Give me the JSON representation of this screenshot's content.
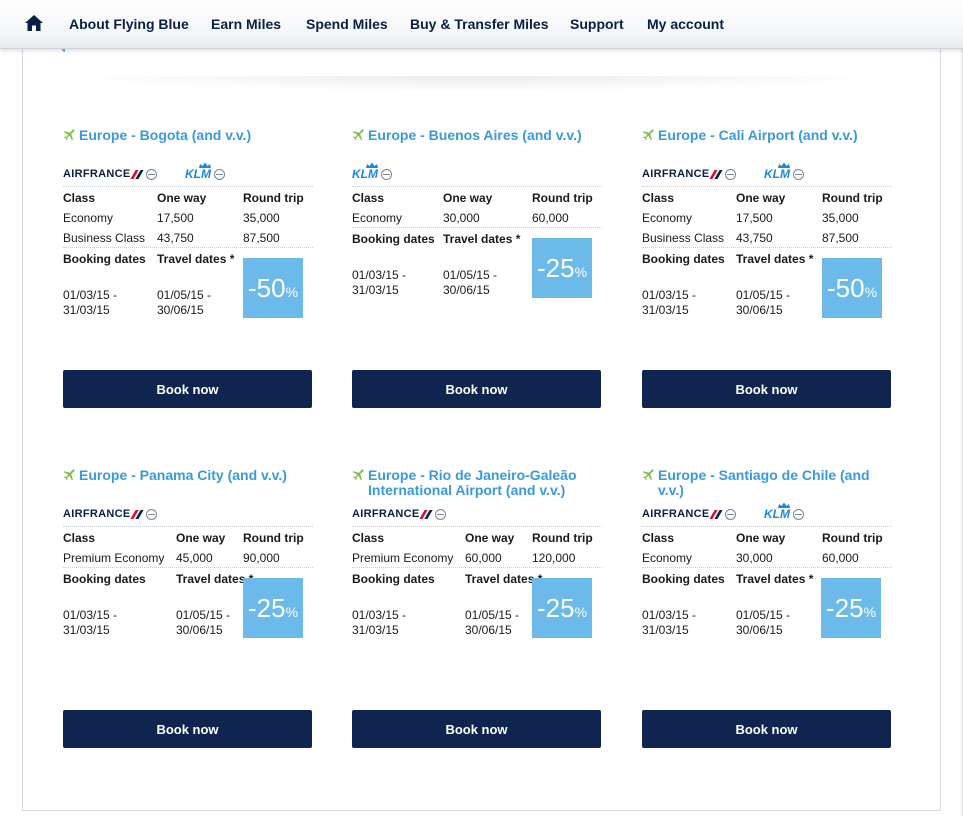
{
  "nav": {
    "items": [
      "About Flying Blue",
      "Earn Miles",
      "Spend Miles",
      "Buy & Transfer Miles",
      "Support",
      "My account"
    ]
  },
  "brand": {
    "airfrance": "AIRFRANCE",
    "klm": "KLM"
  },
  "table_headers": {
    "class": "Class",
    "one_way": "One way",
    "round_trip": "Round trip",
    "booking_dates": "Booking dates",
    "travel_dates": "Travel dates *"
  },
  "offers": [
    {
      "route": "Europe - Bogota (and v.v.)",
      "airlines": [
        "airfrance",
        "klm"
      ],
      "fares": [
        {
          "class": "Economy",
          "one_way": "17,500",
          "round_trip": "35,000"
        },
        {
          "class": "Business Class",
          "one_way": "43,750",
          "round_trip": "87,500"
        }
      ],
      "booking_from": "01/03/15 -",
      "booking_to": "31/03/15",
      "travel_from": "01/05/15 -",
      "travel_to": "30/06/15",
      "discount": "-50",
      "discount_unit": "%",
      "button": "Book now"
    },
    {
      "route": "Europe - Buenos Aires (and v.v.)",
      "airlines": [
        "klm"
      ],
      "fares": [
        {
          "class": "Economy",
          "one_way": "30,000",
          "round_trip": "60,000"
        }
      ],
      "booking_from": "01/03/15 -",
      "booking_to": "31/03/15",
      "travel_from": "01/05/15 -",
      "travel_to": "30/06/15",
      "discount": "-25",
      "discount_unit": "%",
      "button": "Book now"
    },
    {
      "route": "Europe - Cali Airport (and v.v.)",
      "airlines": [
        "airfrance",
        "klm"
      ],
      "fares": [
        {
          "class": "Economy",
          "one_way": "17,500",
          "round_trip": "35,000"
        },
        {
          "class": "Business Class",
          "one_way": "43,750",
          "round_trip": "87,500"
        }
      ],
      "booking_from": "01/03/15 -",
      "booking_to": "31/03/15",
      "travel_from": "01/05/15 -",
      "travel_to": "30/06/15",
      "discount": "-50",
      "discount_unit": "%",
      "button": "Book now"
    },
    {
      "route": "Europe - Panama City (and v.v.)",
      "airlines": [
        "airfrance"
      ],
      "fares": [
        {
          "class": "Premium Economy",
          "one_way": "45,000",
          "round_trip": "90,000"
        }
      ],
      "booking_from": "01/03/15 -",
      "booking_to": "31/03/15",
      "travel_from": "01/05/15 -",
      "travel_to": "30/06/15",
      "discount": "-25",
      "discount_unit": "%",
      "button": "Book now"
    },
    {
      "route": "Europe - Rio de Janeiro-Galeão International Airport (and v.v.)",
      "airlines": [
        "airfrance"
      ],
      "fares": [
        {
          "class": "Premium Economy",
          "one_way": "60,000",
          "round_trip": "120,000"
        }
      ],
      "booking_from": "01/03/15 -",
      "booking_to": "31/03/15",
      "travel_from": "01/05/15 -",
      "travel_to": "30/06/15",
      "discount": "-25",
      "discount_unit": "%",
      "button": "Book now"
    },
    {
      "route": "Europe - Santiago de Chile (and v.v.)",
      "airlines": [
        "airfrance",
        "klm"
      ],
      "fares": [
        {
          "class": "Economy",
          "one_way": "30,000",
          "round_trip": "60,000"
        }
      ],
      "booking_from": "01/03/15 -",
      "booking_to": "31/03/15",
      "travel_from": "01/05/15 -",
      "travel_to": "30/06/15",
      "discount": "-25",
      "discount_unit": "%",
      "button": "Book now"
    }
  ],
  "icons": {
    "home": "home-icon",
    "plane": "plane-icon",
    "skyteam": "skyteam-icon"
  },
  "colors": {
    "nav_text": "#0a1f44",
    "route_link": "#3a9ad9",
    "plane": "#7ac143",
    "discount_bg": "#6bbaea",
    "button_bg": "#0f2550"
  }
}
